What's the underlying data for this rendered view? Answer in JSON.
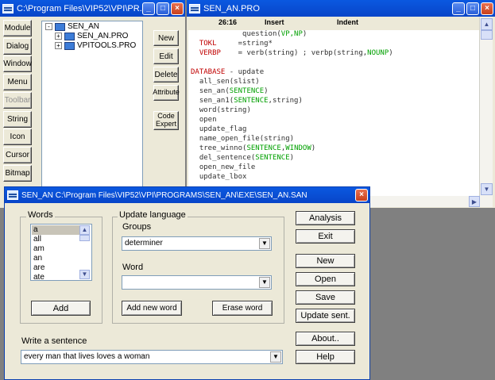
{
  "left_window": {
    "title": "C:\\Program Files\\VIP52\\VPI\\PR...",
    "tool_buttons": [
      "Module",
      "Dialog",
      "Window",
      "Menu",
      "Toolbar",
      "String",
      "Icon",
      "Cursor",
      "Bitmap"
    ],
    "tree": {
      "root": "SEN_AN",
      "children": [
        "SEN_AN.PRO",
        "VPITOOLS.PRO"
      ]
    },
    "action_buttons": [
      "New",
      "Edit",
      "Delete",
      "Attribute",
      "Code Expert"
    ]
  },
  "editor": {
    "title": "SEN_AN.PRO",
    "position": "26:16",
    "mode": "Insert",
    "indent": "Indent"
  },
  "dialog": {
    "title": "SEN_AN  C:\\Program Files\\VIP52\\VPI\\PROGRAMS\\SEN_AN\\EXE\\SEN_AN.SAN",
    "words_label": "Words",
    "words": [
      "a",
      "all",
      "am",
      "an",
      "are",
      "ate"
    ],
    "add_label": "Add",
    "update_label": "Update language",
    "groups_label": "Groups",
    "groups_value": "determiner",
    "word_label": "Word",
    "word_value": "",
    "add_new_word": "Add new word",
    "erase_word": "Erase word",
    "sentence_label": "Write a sentence",
    "sentence_value": "every man that lives loves a woman",
    "buttons": [
      "Analysis",
      "Exit",
      "New",
      "Open",
      "Save",
      "Update sent.",
      "About..",
      "Help"
    ]
  }
}
